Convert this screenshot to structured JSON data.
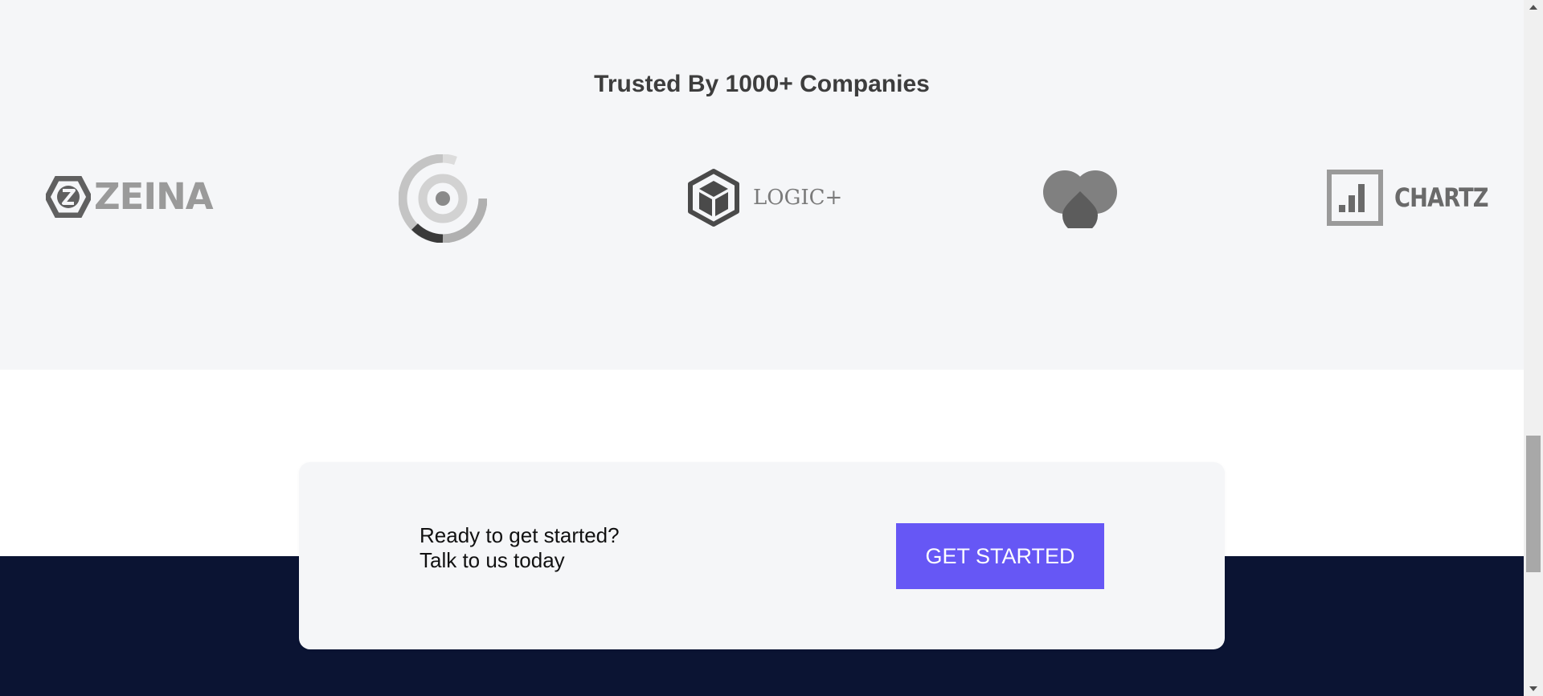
{
  "trusted": {
    "heading": "Trusted By 1000+ Companies",
    "logos": [
      {
        "name": "ZEINA",
        "icon": "hexagon-z-icon"
      },
      {
        "name": "",
        "icon": "concentric-rings-icon"
      },
      {
        "name": "LOGIC+",
        "icon": "cube-icon"
      },
      {
        "name": "",
        "icon": "heart-drops-icon"
      },
      {
        "name": "CHARTZ",
        "icon": "bar-chart-square-icon"
      }
    ]
  },
  "cta": {
    "line1": "Ready to get started?",
    "line2": "Talk to us today",
    "button_label": "GET STARTED"
  },
  "colors": {
    "accent": "#6657f5",
    "footer": "#0b1433",
    "section_bg": "#f5f6f8"
  }
}
